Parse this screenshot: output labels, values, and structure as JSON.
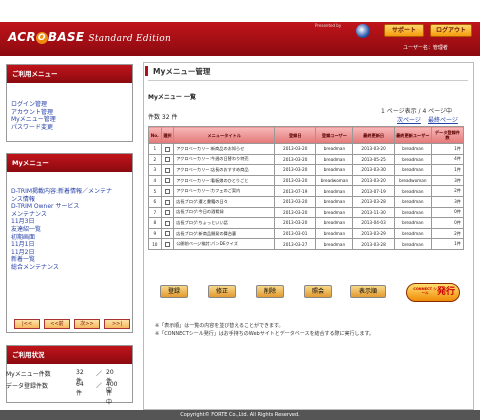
{
  "header": {
    "logo_main": "ACR",
    "logo_rest": "BASE",
    "logo_o": "O",
    "logo_sub": "Standard Edition",
    "presented_by": "Presented by",
    "support_label": "サポート",
    "logout_label": "ログアウト",
    "user_text": "ユーザー名：管理者"
  },
  "sidebar": {
    "menu_title": "ご利用メニュー",
    "menu_links": [
      "ログイン管理",
      "アカウント管理",
      "Myメニュー管理",
      "パスワード変更"
    ],
    "my_title": "Myメニュー",
    "my_links": [
      "D-TRIM掲載内容:新着情報／メンテナ",
      "ンス情報",
      "D-TRIM Owner サービス",
      "メンテナンス",
      "11月3日",
      "友達紹一覧",
      "初期画面",
      "11月1日",
      "11月2日",
      "新着一覧",
      "総合メンテナンス"
    ],
    "pager": [
      "|<<",
      "<<前",
      "次>>",
      ">>|"
    ],
    "status_title": "ご利用状況",
    "stats": [
      {
        "label": "Myメニュー件数",
        "used": "32件",
        "sep": "／",
        "max": "20件中"
      },
      {
        "label": "データ登録件数",
        "used": "64件",
        "sep": "／",
        "max": "400件中"
      }
    ]
  },
  "main": {
    "title": "Myメニュー管理",
    "section": "Myメニュー 一覧",
    "count": "件数 32 件",
    "page_info": "1 ページ表示 / 4 ページ中",
    "next_link": "次ページ",
    "last_link": "最終ページ",
    "columns": [
      "No.",
      "選択",
      "メニュータイトル",
      "登録日",
      "登録ユーザー",
      "最終更新日",
      "最終更新ユーザー",
      "データ登録件数"
    ],
    "rows": [
      [
        "1",
        "",
        "アクロベーカリー:新商品のお知らせ",
        "2013-03-20",
        "breadman",
        "2013-03-20",
        "breadman",
        "1件"
      ],
      [
        "2",
        "",
        "アクロベーカリー:今週の日替わり特売",
        "2013-03-20",
        "breadman",
        "2013-05-25",
        "breadman",
        "4件"
      ],
      [
        "3",
        "",
        "アクロベーカリー:店長のおすすめ商品",
        "2013-03-20",
        "breadman",
        "2013-03-30",
        "breadman",
        "1件"
      ],
      [
        "4",
        "",
        "アクロベーカリー:看板娘のひとりごと",
        "2013-03-20",
        "breadwoman",
        "2013-03-20",
        "breadwoman",
        "3件"
      ],
      [
        "5",
        "",
        "アクロベーカリー:カフェのご案内",
        "2013-07-19",
        "breadman",
        "2013-07-19",
        "breadman",
        "2件"
      ],
      [
        "6",
        "",
        "店長ブログ:遭と書籍の日々",
        "2013-03-20",
        "breadman",
        "2013-03-28",
        "breadman",
        "3件"
      ],
      [
        "7",
        "",
        "店長ブログ:今日の酒肴録",
        "2013-03-20",
        "breadman",
        "2013-11-30",
        "breadman",
        "0件"
      ],
      [
        "8",
        "",
        "店長ブログ:ちょっといい話",
        "2013-03-20",
        "breadman",
        "2013-04-03",
        "breadman",
        "0件"
      ],
      [
        "9",
        "",
        "店長ブログ:新商品開発の舞台裏",
        "2013-03-01",
        "breadman",
        "2013-03-29",
        "breadman",
        "2件"
      ],
      [
        "10",
        "",
        "公開前ページ検討:パンDEクイズ",
        "2013-03-27",
        "breadman",
        "2013-03-28",
        "breadman",
        "1件"
      ]
    ],
    "buttons": [
      "登録",
      "修正",
      "削除",
      "照会",
      "表示順"
    ],
    "issue_small": "CONNECT シール",
    "issue_label": "発行",
    "notes": [
      "※「表示順」は一覧の内容を並び替えることができます。",
      "※「CONNECTシール発行」はお手持ちのWebサイトとデータベースを結合する際に実行します。"
    ]
  },
  "footer": "Copyright© FORTE Co.,Ltd. All Rights Reserved.",
  "colors": {
    "brand_red": "#b01018",
    "accent_orange": "#f49c0c",
    "link_blue": "#2742a8"
  }
}
